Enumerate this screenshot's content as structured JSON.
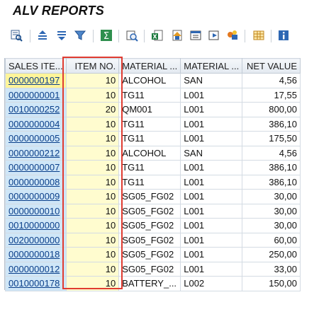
{
  "window": {
    "title": "ALV REPORTS"
  },
  "toolbar": {
    "buttons": [
      {
        "name": "details-icon"
      },
      {
        "name": "sort-ascending-icon"
      },
      {
        "name": "sort-descending-icon"
      },
      {
        "name": "filter-icon"
      },
      {
        "name": "sum-icon"
      },
      {
        "name": "print-preview-icon"
      },
      {
        "name": "export-excel-icon"
      },
      {
        "name": "word-processing-icon"
      },
      {
        "name": "local-file-icon"
      },
      {
        "name": "mail-recipient-icon"
      },
      {
        "name": "abc-analysis-icon"
      },
      {
        "name": "change-layout-icon"
      },
      {
        "name": "info-icon"
      }
    ]
  },
  "grid": {
    "columns": {
      "sales_item": "SALES ITE...",
      "item_no": "ITEM NO.",
      "material": "MATERIAL ...",
      "material2": "MATERIAL ...",
      "net_value": "NET VALUE"
    },
    "rows": [
      {
        "sales_item": "0000000197",
        "item_no": "10",
        "material": "ALCOHOL",
        "material2": "SAN",
        "net_value": "4,56"
      },
      {
        "sales_item": "0000000001",
        "item_no": "10",
        "material": "TG11",
        "material2": "L001",
        "net_value": "17,55"
      },
      {
        "sales_item": "0010000252",
        "item_no": "20",
        "material": "QM001",
        "material2": "L001",
        "net_value": "800,00"
      },
      {
        "sales_item": "0000000004",
        "item_no": "10",
        "material": "TG11",
        "material2": "L001",
        "net_value": "386,10"
      },
      {
        "sales_item": "0000000005",
        "item_no": "10",
        "material": "TG11",
        "material2": "L001",
        "net_value": "175,50"
      },
      {
        "sales_item": "0000000212",
        "item_no": "10",
        "material": "ALCOHOL",
        "material2": "SAN",
        "net_value": "4,56"
      },
      {
        "sales_item": "0000000007",
        "item_no": "10",
        "material": "TG11",
        "material2": "L001",
        "net_value": "386,10"
      },
      {
        "sales_item": "0000000008",
        "item_no": "10",
        "material": "TG11",
        "material2": "L001",
        "net_value": "386,10"
      },
      {
        "sales_item": "0000000009",
        "item_no": "10",
        "material": "SG05_FG02",
        "material2": "L001",
        "net_value": "30,00"
      },
      {
        "sales_item": "0000000010",
        "item_no": "10",
        "material": "SG05_FG02",
        "material2": "L001",
        "net_value": "30,00"
      },
      {
        "sales_item": "0010000000",
        "item_no": "10",
        "material": "SG05_FG02",
        "material2": "L001",
        "net_value": "30,00"
      },
      {
        "sales_item": "0020000000",
        "item_no": "10",
        "material": "SG05_FG02",
        "material2": "L001",
        "net_value": "60,00"
      },
      {
        "sales_item": "0000000018",
        "item_no": "10",
        "material": "SG05_FG02",
        "material2": "L001",
        "net_value": "250,00"
      },
      {
        "sales_item": "0000000012",
        "item_no": "10",
        "material": "SG05_FG02",
        "material2": "L001",
        "net_value": "33,00"
      },
      {
        "sales_item": "0010000178",
        "item_no": "10",
        "material": "BATTERY_...",
        "material2": "L002",
        "net_value": "150,00"
      }
    ]
  },
  "colors": {
    "sales_item_bg": "#cfe6f7",
    "item_no_bg": "#fffccf",
    "selected_cell_bg": "#fff59a",
    "highlight_border": "#e03c31",
    "link_text": "#0a3f8a"
  }
}
